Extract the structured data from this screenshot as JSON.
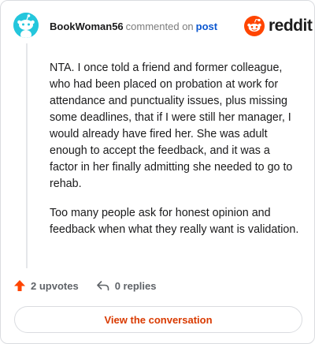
{
  "comment": {
    "username": "BookWoman56",
    "verb": "commented on",
    "post_link": "post",
    "paragraphs": [
      "NTA. I once told a friend and former colleague, who had been placed on probation at work for attendance and punctuality issues, plus missing some deadlines, that if I were still her manager, I would already have fired her. She was adult enough to accept the feedback, and it was a factor in her finally admitting she needed to go to rehab.",
      "Too many people ask for honest opinion and feedback when what they really want is validation."
    ]
  },
  "brand": {
    "name": "reddit",
    "color": "#ff4500"
  },
  "actions": {
    "upvotes": "2 upvotes",
    "replies": "0 replies"
  },
  "view_button": "View the conversation",
  "colors": {
    "avatar": "#24c6dc",
    "accent": "#d93a00",
    "link": "#0b57d0"
  }
}
